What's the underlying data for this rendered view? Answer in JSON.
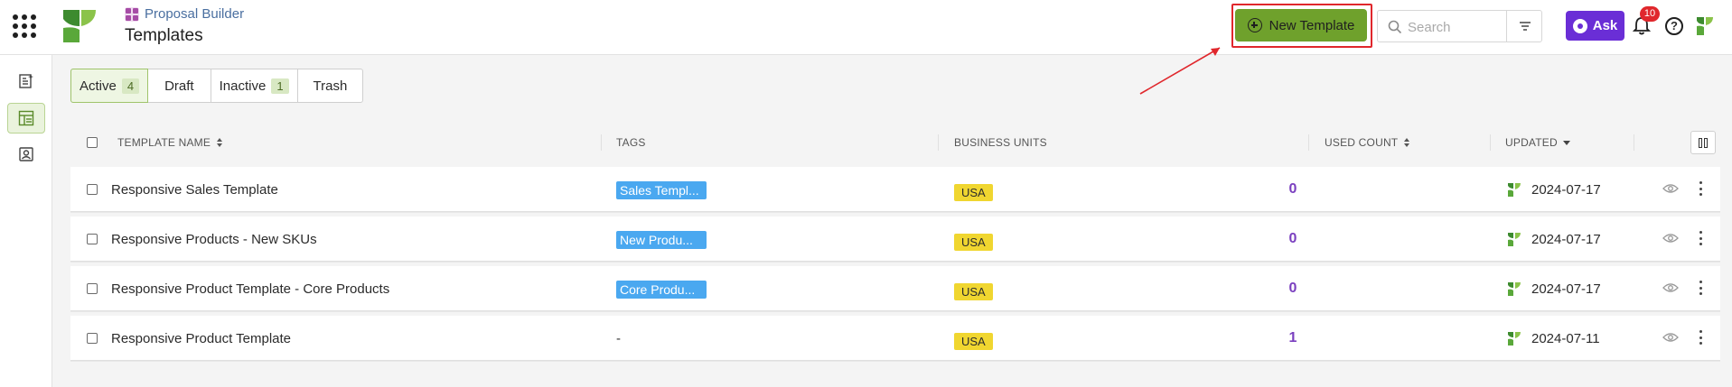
{
  "header": {
    "app_name": "Proposal Builder",
    "page_title": "Templates",
    "new_template_label": "New Template",
    "search_placeholder": "Search",
    "ask_label": "Ask",
    "notifications_count": "10",
    "help_glyph": "?"
  },
  "tabs": [
    {
      "label": "Active",
      "count": "4",
      "active": true
    },
    {
      "label": "Draft",
      "count": "",
      "active": false
    },
    {
      "label": "Inactive",
      "count": "1",
      "active": false
    },
    {
      "label": "Trash",
      "count": "",
      "active": false
    }
  ],
  "table": {
    "columns": {
      "name": "TEMPLATE NAME",
      "tags": "TAGS",
      "business_units": "BUSINESS UNITS",
      "used_count": "USED COUNT",
      "updated": "UPDATED"
    },
    "rows": [
      {
        "name": "Responsive Sales Template",
        "tag": "Sales Templ...",
        "business_unit": "USA",
        "used_count": "0",
        "updated": "2024-07-17"
      },
      {
        "name": "Responsive Products - New SKUs",
        "tag": "New Produ...",
        "business_unit": "USA",
        "used_count": "0",
        "updated": "2024-07-17"
      },
      {
        "name": "Responsive Product Template - Core Products",
        "tag": "Core Produ...",
        "business_unit": "USA",
        "used_count": "0",
        "updated": "2024-07-17"
      },
      {
        "name": "Responsive Product Template",
        "tag": "-",
        "business_unit": "USA",
        "used_count": "1",
        "updated": "2024-07-11"
      }
    ]
  },
  "colors": {
    "primary_green": "#6fa12c",
    "ask_purple": "#6a2ed6",
    "tag_blue": "#4aa8f0",
    "bu_yellow": "#f0d630",
    "count_purple": "#7a3fbf",
    "highlight_red": "#e0272c"
  },
  "icons": [
    "apps-grid-icon",
    "company-logo",
    "proposal-builder-icon",
    "plus-circle-icon",
    "search-icon",
    "filter-icon",
    "ask-icon",
    "bell-icon",
    "help-icon",
    "user-logo",
    "eye-icon",
    "kebab-menu-icon",
    "columns-icon"
  ]
}
